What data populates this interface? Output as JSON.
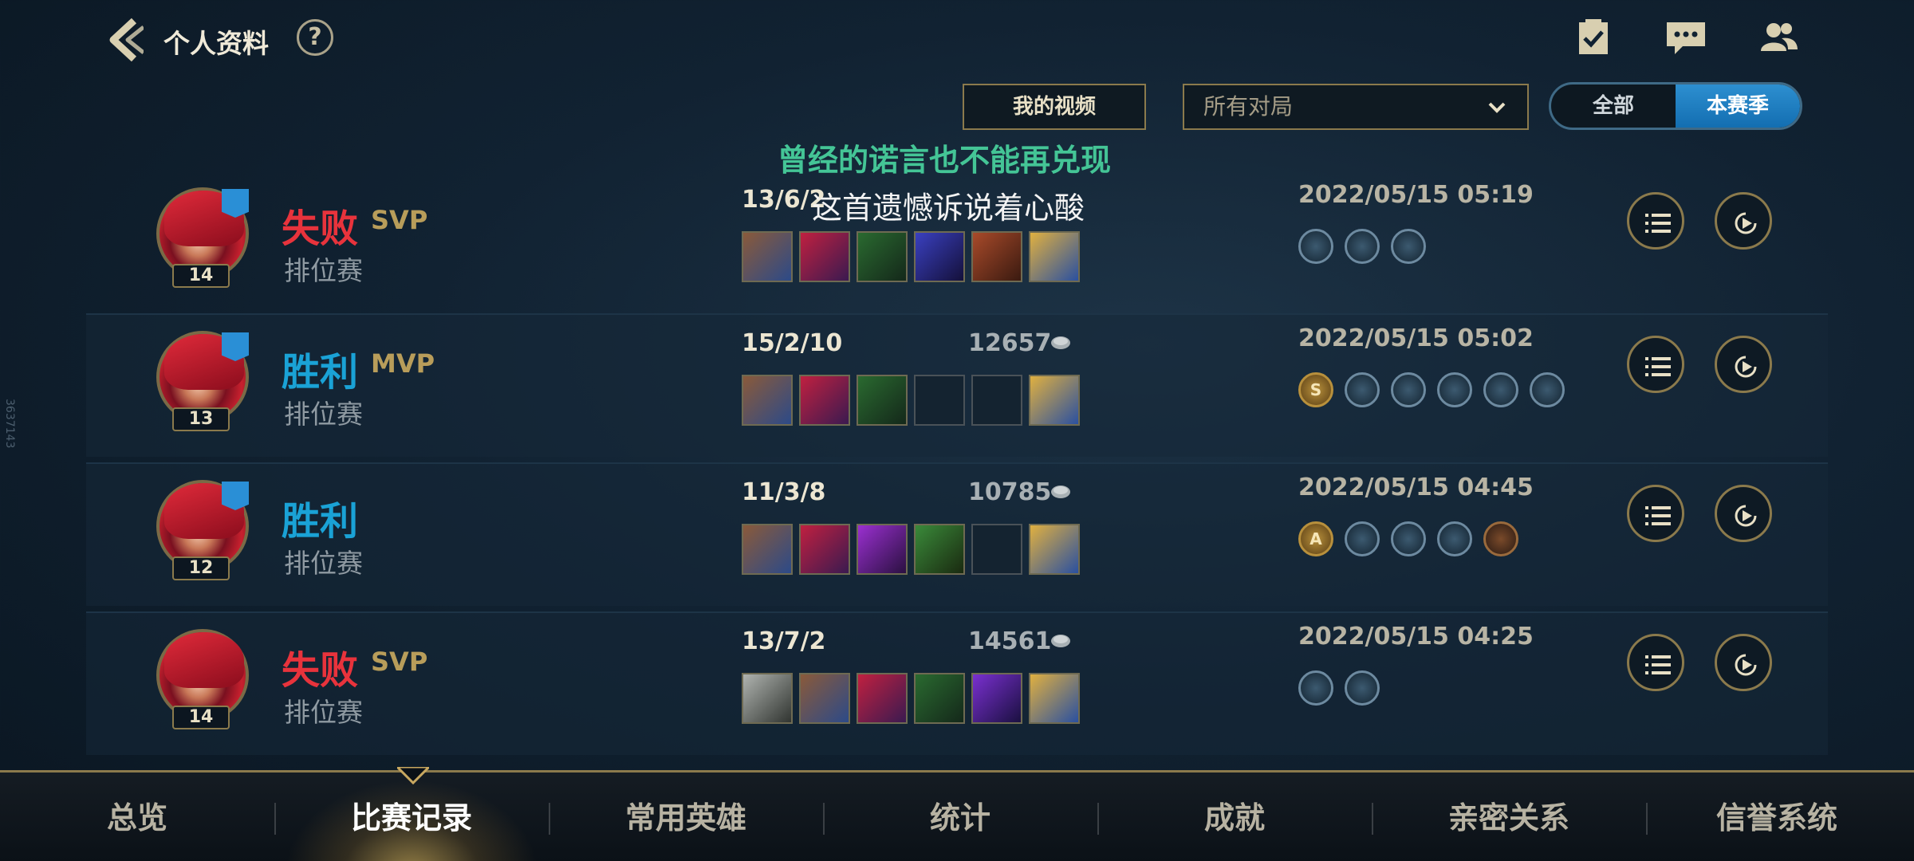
{
  "header": {
    "title": "个人资料",
    "help_label": "?"
  },
  "controls": {
    "video_button": "我的视频",
    "filter_select_value": "所有对局",
    "season_toggle": {
      "options": [
        "全部",
        "本赛季"
      ],
      "selected": "本赛季"
    }
  },
  "lyrics": {
    "line1": "曾经的诺言也不能再兑现",
    "line2": "这首遗憾诉说着心酸"
  },
  "matches": [
    {
      "result": "失败",
      "result_type": "loss",
      "medal": "SVP",
      "mode": "排位赛",
      "level": "14",
      "kda": "13/6/2",
      "gold": "",
      "date": "2022/05/15 05:19",
      "items": [
        "item",
        "item",
        "item",
        "item",
        "item",
        "item"
      ],
      "tags": [
        "",
        "",
        ""
      ]
    },
    {
      "result": "胜利",
      "result_type": "win",
      "medal": "MVP",
      "mode": "排位赛",
      "level": "13",
      "kda": "15/2/10",
      "gold": "12657",
      "date": "2022/05/15 05:02",
      "items": [
        "item",
        "item",
        "item",
        "empty",
        "empty",
        "item"
      ],
      "tags": [
        "S",
        "",
        "",
        "",
        "",
        ""
      ]
    },
    {
      "result": "胜利",
      "result_type": "win",
      "medal": "",
      "mode": "排位赛",
      "level": "12",
      "kda": "11/3/8",
      "gold": "10785",
      "date": "2022/05/15 04:45",
      "items": [
        "item",
        "item",
        "item",
        "item",
        "empty",
        "item"
      ],
      "tags": [
        "A",
        "",
        "",
        "",
        ""
      ]
    },
    {
      "result": "失败",
      "result_type": "loss",
      "medal": "SVP",
      "mode": "排位赛",
      "level": "14",
      "kda": "13/7/2",
      "gold": "14561",
      "date": "2022/05/15 04:25",
      "items": [
        "item",
        "item",
        "item",
        "item",
        "item",
        "item"
      ],
      "tags": [
        "",
        ""
      ]
    }
  ],
  "bottom_nav": {
    "tabs": [
      "总览",
      "比赛记录",
      "常用英雄",
      "统计",
      "成就",
      "亲密关系",
      "信誉系统"
    ],
    "active": "比赛记录"
  },
  "side_watermark": "3637143",
  "colors": {
    "win": "#1aa2d6",
    "loss": "#e8333c",
    "gold_accent": "#8b7a4c",
    "lyric_green": "#44c596"
  }
}
